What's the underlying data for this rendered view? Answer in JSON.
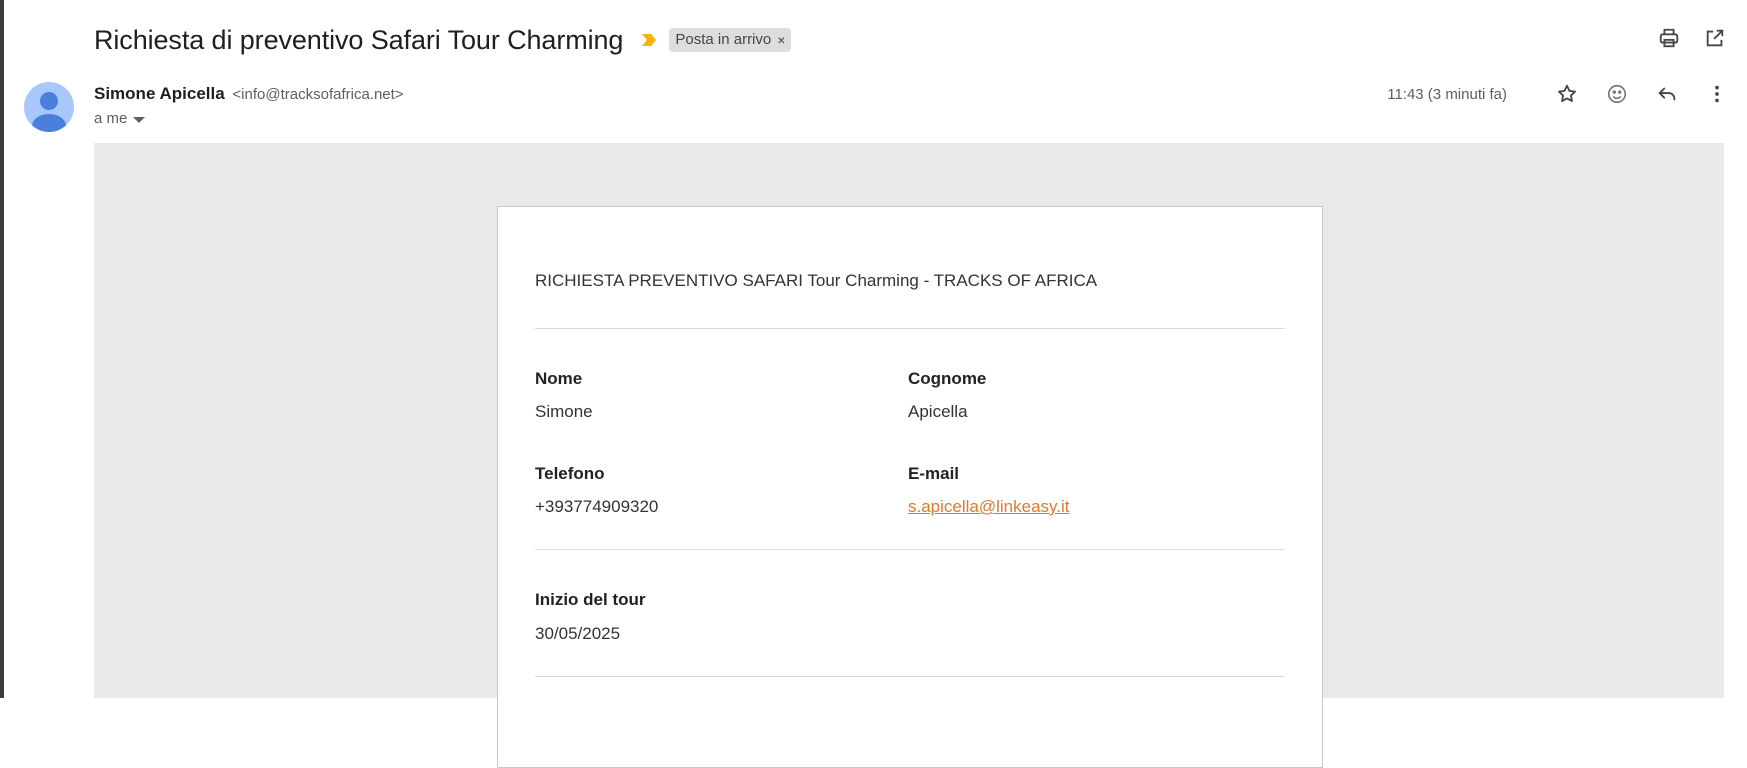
{
  "email": {
    "subject": "Richiesta di preventivo Safari Tour Charming",
    "label_chip": "Posta in arrivo",
    "chip_close": "×",
    "sender_name": "Simone Apicella",
    "sender_email": "<info@tracksofafrica.net>",
    "to": "a me",
    "timestamp": "11:43 (3 minuti fa)"
  },
  "icons": {
    "importance": "importance-marker-icon",
    "print": "print-icon",
    "open_new_window": "open-in-new-window-icon",
    "star": "star-icon",
    "emoji": "emoji-reaction-icon",
    "reply": "reply-icon",
    "more": "more-vert-icon",
    "avatar": "default-avatar-icon"
  },
  "colors": {
    "importance": "#f4b400",
    "avatar_bg": "#a8c7fa",
    "avatar_fg": "#4a7fdc",
    "canvas_bg": "#e8e9eb",
    "link": "#e07a2b"
  },
  "body": {
    "title": "RICHIESTA PREVENTIVO SAFARI Tour Charming - TRACKS OF AFRICA",
    "fields": {
      "nome_label": "Nome",
      "nome_value": "Simone",
      "cognome_label": "Cognome",
      "cognome_value": "Apicella",
      "telefono_label": "Telefono",
      "telefono_value": "+393774909320",
      "email_label": "E-mail",
      "email_value": "s.apicella@linkeasy.it",
      "inizio_label": "Inizio del tour",
      "inizio_value": "30/05/2025"
    }
  }
}
